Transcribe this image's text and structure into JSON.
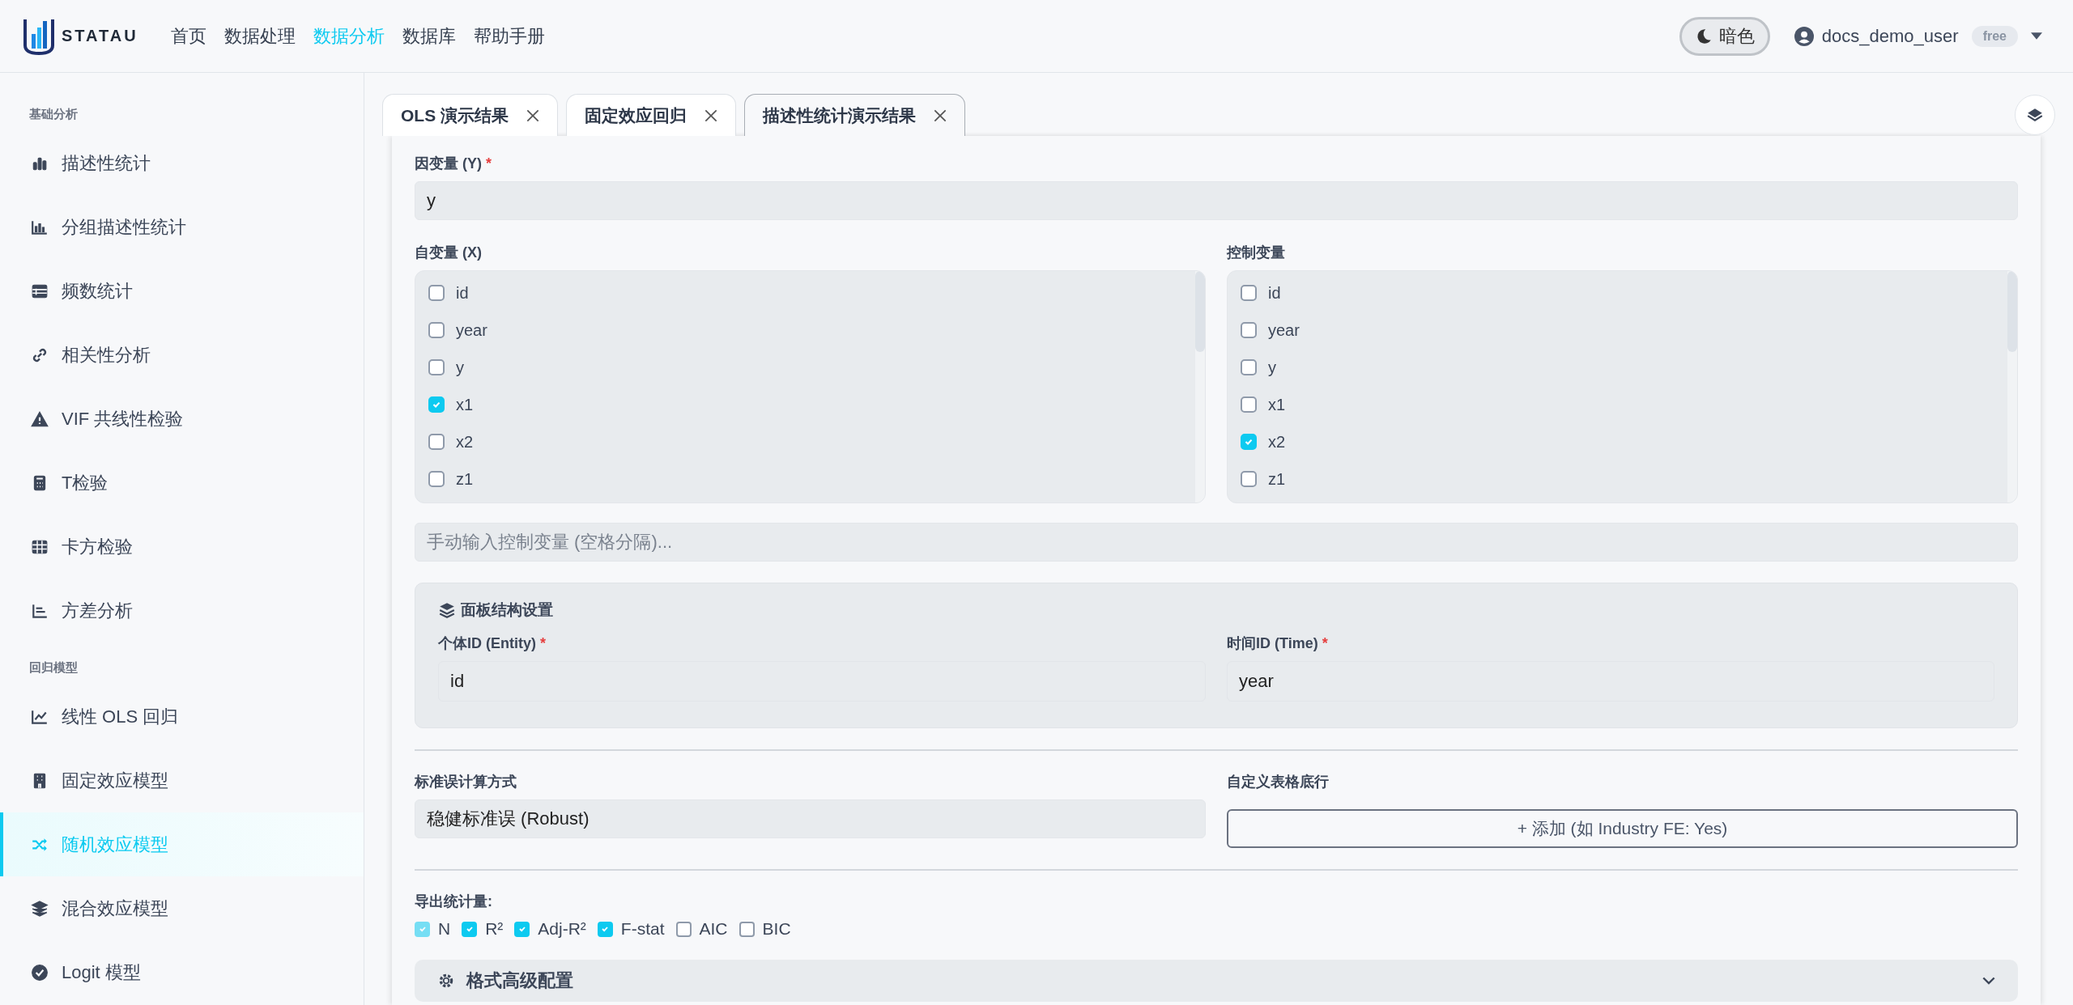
{
  "brand": {
    "name": "STATAU"
  },
  "nav": [
    {
      "label": "首页",
      "selected": false
    },
    {
      "label": "数据处理",
      "selected": false
    },
    {
      "label": "数据分析",
      "selected": true
    },
    {
      "label": "数据库",
      "selected": false
    },
    {
      "label": "帮助手册",
      "selected": false
    }
  ],
  "theme_toggle": {
    "label": "暗色"
  },
  "user": {
    "name": "docs_demo_user",
    "plan": "free"
  },
  "sidebar": {
    "sections": [
      {
        "title": "基础分析",
        "items": [
          {
            "label": "描述性统计",
            "selected": false
          },
          {
            "label": "分组描述性统计",
            "selected": false
          },
          {
            "label": "频数统计",
            "selected": false
          },
          {
            "label": "相关性分析",
            "selected": false
          },
          {
            "label": "VIF 共线性检验",
            "selected": false
          },
          {
            "label": "T检验",
            "selected": false
          },
          {
            "label": "卡方检验",
            "selected": false
          },
          {
            "label": "方差分析",
            "selected": false
          }
        ]
      },
      {
        "title": "回归模型",
        "items": [
          {
            "label": "线性 OLS 回归",
            "selected": false
          },
          {
            "label": "固定效应模型",
            "selected": false
          },
          {
            "label": "随机效应模型",
            "selected": true
          },
          {
            "label": "混合效应模型",
            "selected": false
          },
          {
            "label": "Logit 模型",
            "selected": false
          }
        ]
      }
    ]
  },
  "tabs": [
    {
      "label": "OLS 演示结果",
      "selected": false
    },
    {
      "label": "固定效应回归",
      "selected": false
    },
    {
      "label": "描述性统计演示结果",
      "selected": true
    }
  ],
  "form": {
    "dependent": {
      "label": "因变量 (Y)",
      "required_mark": "*",
      "value": "y"
    },
    "independent": {
      "label": "自变量 (X)",
      "options": [
        {
          "label": "id",
          "checked": false
        },
        {
          "label": "year",
          "checked": false
        },
        {
          "label": "y",
          "checked": false
        },
        {
          "label": "x1",
          "checked": true
        },
        {
          "label": "x2",
          "checked": false
        },
        {
          "label": "z1",
          "checked": false
        }
      ]
    },
    "controls": {
      "label": "控制变量",
      "options": [
        {
          "label": "id",
          "checked": false
        },
        {
          "label": "year",
          "checked": false
        },
        {
          "label": "y",
          "checked": false
        },
        {
          "label": "x1",
          "checked": false
        },
        {
          "label": "x2",
          "checked": true
        },
        {
          "label": "z1",
          "checked": false
        }
      ]
    },
    "manual_input": {
      "placeholder": "手动输入控制变量 (空格分隔)..."
    },
    "panel": {
      "title": "面板结构设置",
      "entity": {
        "label": "个体ID (Entity)",
        "required_mark": "*",
        "value": "id"
      },
      "time": {
        "label": "时间ID (Time)",
        "required_mark": "*",
        "value": "year"
      }
    },
    "se": {
      "label": "标准误计算方式",
      "value": "稳健标准误 (Robust)"
    },
    "footer_rows": {
      "label": "自定义表格底行",
      "button": "+ 添加 (如 Industry FE: Yes)"
    },
    "export": {
      "label": "导出统计量:",
      "options": [
        {
          "label": "N",
          "checked": true,
          "disabled": true
        },
        {
          "label": "R²",
          "checked": true,
          "disabled": false
        },
        {
          "label": "Adj-R²",
          "checked": true,
          "disabled": false
        },
        {
          "label": "F-stat",
          "checked": true,
          "disabled": false
        },
        {
          "label": "AIC",
          "checked": false,
          "disabled": false
        },
        {
          "label": "BIC",
          "checked": false,
          "disabled": false
        }
      ]
    },
    "advanced": {
      "title": "格式高级配置"
    }
  }
}
